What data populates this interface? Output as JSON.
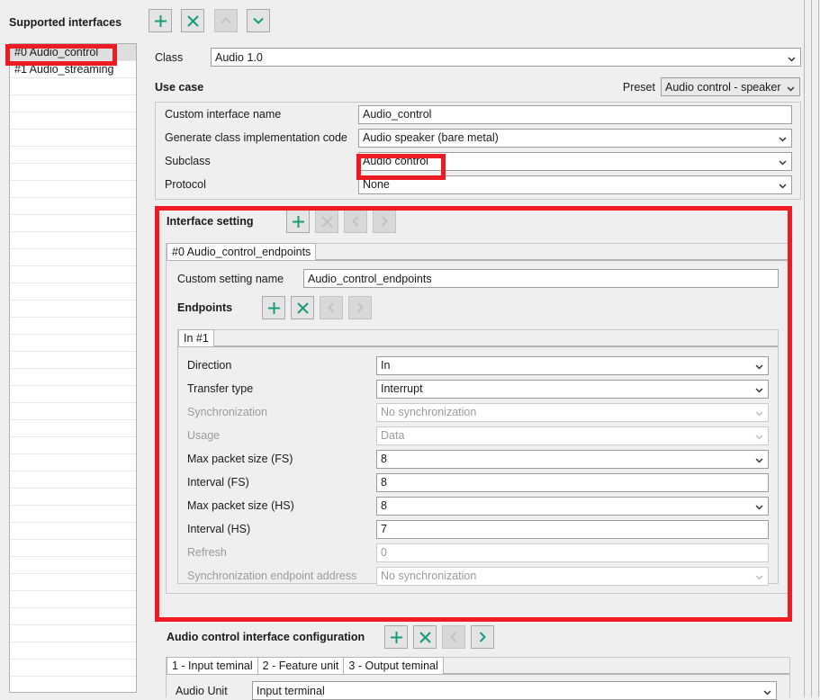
{
  "sidebar": {
    "title": "Supported interfaces",
    "items": [
      {
        "label": "#0 Audio_control",
        "selected": true
      },
      {
        "label": "#1 Audio_streaming",
        "selected": false
      }
    ],
    "empty_row_count": 36
  },
  "toolbar": {
    "add_label": "+",
    "delete_label": "×",
    "up_label": "up-chevron",
    "down_label": "down-chevron"
  },
  "class_row": {
    "label": "Class",
    "value": "Audio 1.0"
  },
  "use_case": {
    "title": "Use case",
    "preset_label": "Preset",
    "preset_value": "Audio control - speaker",
    "rows": [
      {
        "label": "Custom interface name",
        "value": "Audio_control",
        "type": "text",
        "disabled": false
      },
      {
        "label": "Generate class implementation code",
        "value": "Audio speaker (bare metal)",
        "type": "select",
        "disabled": false
      },
      {
        "label": "Subclass",
        "value": "Audio control",
        "type": "select",
        "disabled": false
      },
      {
        "label": "Protocol",
        "value": "None",
        "type": "select",
        "disabled": false
      }
    ]
  },
  "interface_setting": {
    "title": "Interface setting",
    "buttons": [
      {
        "name": "add",
        "glyph": "+",
        "enabled": true
      },
      {
        "name": "delete",
        "glyph": "×",
        "enabled": false
      },
      {
        "name": "prev",
        "glyph": "‹",
        "enabled": false
      },
      {
        "name": "next",
        "glyph": "›",
        "enabled": false
      }
    ],
    "tabs": [
      {
        "label": "#0 Audio_control_endpoints",
        "active": true
      }
    ],
    "custom_setting_name_label": "Custom setting name",
    "custom_setting_name_value": "Audio_control_endpoints",
    "endpoints": {
      "title": "Endpoints",
      "buttons": [
        {
          "name": "add",
          "glyph": "+",
          "enabled": true
        },
        {
          "name": "delete",
          "glyph": "×",
          "enabled": true
        },
        {
          "name": "prev",
          "glyph": "‹",
          "enabled": false
        },
        {
          "name": "next",
          "glyph": "›",
          "enabled": false
        }
      ],
      "tabs": [
        {
          "label": "In #1",
          "active": true
        }
      ],
      "rows": [
        {
          "label": "Direction",
          "value": "In",
          "type": "select",
          "disabled": false
        },
        {
          "label": "Transfer type",
          "value": "Interrupt",
          "type": "select",
          "disabled": false
        },
        {
          "label": "Synchronization",
          "value": "No synchronization",
          "type": "select",
          "disabled": true
        },
        {
          "label": "Usage",
          "value": "Data",
          "type": "select",
          "disabled": true
        },
        {
          "label": "Max packet size (FS)",
          "value": "8",
          "type": "select",
          "disabled": false
        },
        {
          "label": "Interval (FS)",
          "value": "8",
          "type": "text",
          "disabled": false
        },
        {
          "label": "Max packet size (HS)",
          "value": "8",
          "type": "select",
          "disabled": false
        },
        {
          "label": "Interval (HS)",
          "value": "7",
          "type": "text",
          "disabled": false
        },
        {
          "label": "Refresh",
          "value": "0",
          "type": "text",
          "disabled": true
        },
        {
          "label": "Synchronization endpoint address",
          "value": "No synchronization",
          "type": "select",
          "disabled": true
        }
      ]
    }
  },
  "audio_control_config": {
    "title": "Audio control interface configuration",
    "buttons": [
      {
        "name": "add",
        "glyph": "+",
        "enabled": true
      },
      {
        "name": "delete",
        "glyph": "×",
        "enabled": true
      },
      {
        "name": "prev",
        "glyph": "‹",
        "enabled": false
      },
      {
        "name": "next",
        "glyph": "›",
        "enabled": true
      }
    ],
    "tabs": [
      {
        "label": "1 - Input teminal",
        "active": true
      },
      {
        "label": "2 - Feature unit",
        "active": false
      },
      {
        "label": "3 - Output teminal",
        "active": false
      }
    ],
    "audio_unit_label": "Audio Unit",
    "audio_unit_value": "Input terminal"
  },
  "annotations": {
    "highlight_color": "#ed1c24",
    "boxes": [
      {
        "name": "sidebar-selected-item-highlight"
      },
      {
        "name": "subclass-value-highlight"
      },
      {
        "name": "interface-setting-section-highlight"
      }
    ]
  },
  "colors": {
    "accent_green": "#1a9b78",
    "window_bg": "#efefef",
    "field_bg": "#ffffff"
  }
}
